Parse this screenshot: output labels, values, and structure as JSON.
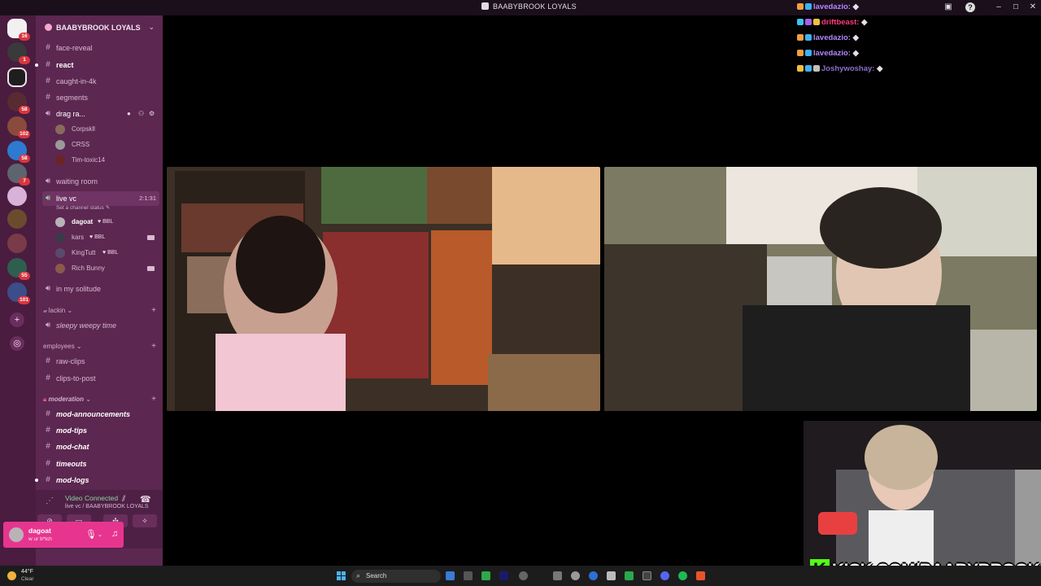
{
  "window": {
    "title": "BAABYBROOK LOYALS"
  },
  "rail": {
    "badges": [
      "16",
      "1",
      "58",
      "102",
      "58",
      "7",
      "55",
      "101"
    ]
  },
  "server": {
    "name": "BAABYBROOK LOYALS"
  },
  "channels": {
    "face_reveal": "face-reveal",
    "react": "react",
    "caught_in_4k": "caught-in-4k",
    "segments": "segments",
    "drag": "drag ra...",
    "drag_users": [
      "Corpskll",
      "CRSS",
      "Tim-toxic14"
    ],
    "waiting_room": "waiting room",
    "live_vc": "live vc",
    "live_vc_timer": "2:1:31",
    "live_vc_status": "Set a channel status",
    "live_users": [
      {
        "name": "dagoat",
        "tag": "BBL"
      },
      {
        "name": "kars",
        "tag": "BBL"
      },
      {
        "name": "KingTutt",
        "tag": "BBL"
      },
      {
        "name": "Rich Bunny",
        "tag": ""
      }
    ],
    "in_my_solitude": "in my solitude",
    "cat_lackin": "lackin",
    "sleepy": "sleepy weepy time",
    "cat_employees": "employees",
    "raw_clips": "raw-clips",
    "clips_to_post": "clips-to-post",
    "cat_moderation": "moderation",
    "mod_announcements": "mod-announcements",
    "mod_tips": "mod-tips",
    "mod_chat": "mod-chat",
    "timeouts": "timeouts",
    "mod_logs": "mod-logs"
  },
  "voice_panel": {
    "status": "Video Connected",
    "location": "live vc / BAABYBROOK LOYALS"
  },
  "user": {
    "name": "dagoat",
    "status": "w ur b*tch"
  },
  "chat": [
    {
      "user": "lavedazio:",
      "color": "#b388ff"
    },
    {
      "user": "driftbeast:",
      "color": "#ff3c7e"
    },
    {
      "user": "lavedazio:",
      "color": "#b388ff"
    },
    {
      "user": "lavedazio:",
      "color": "#b388ff"
    },
    {
      "user": "Joshywoshay:",
      "color": "#8e6ec9"
    }
  ],
  "stream": {
    "kick_text": "KICK.COM/BAABYBROOK",
    "kick_logo": "K"
  },
  "taskbar": {
    "temp": "44°F",
    "condition": "Clear",
    "search": "Search"
  }
}
